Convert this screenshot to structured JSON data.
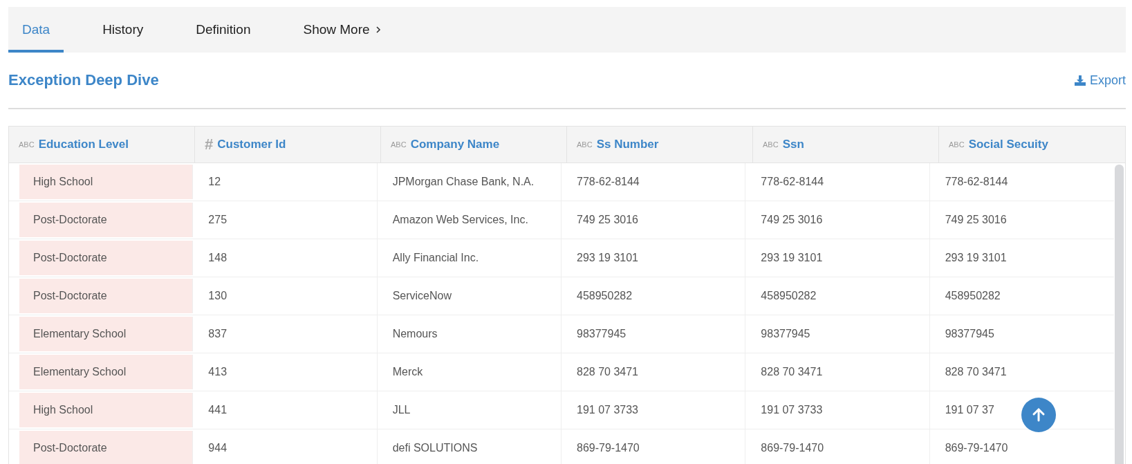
{
  "tabs": [
    {
      "label": "Data",
      "selected": true,
      "kind": "tab"
    },
    {
      "label": "History",
      "selected": false,
      "kind": "tab"
    },
    {
      "label": "Definition",
      "selected": false,
      "kind": "tab"
    },
    {
      "label": "Show More",
      "selected": false,
      "kind": "more"
    }
  ],
  "section": {
    "title": "Exception Deep Dive",
    "export_label": "Export"
  },
  "table": {
    "columns": [
      {
        "label": "Education Level",
        "kind": "text",
        "type_label": "ABC"
      },
      {
        "label": "Customer Id",
        "kind": "number",
        "type_label": "#"
      },
      {
        "label": "Company Name",
        "kind": "text",
        "type_label": "ABC"
      },
      {
        "label": "Ss Number",
        "kind": "text",
        "type_label": "ABC"
      },
      {
        "label": "Ssn",
        "kind": "text",
        "type_label": "ABC"
      },
      {
        "label": "Social Secuity",
        "kind": "text",
        "type_label": "ABC"
      }
    ],
    "rows": [
      {
        "flagged": true,
        "cells": [
          "High School",
          "12",
          "JPMorgan Chase Bank, N.A.",
          "778-62-8144",
          "778-62-8144",
          "778-62-8144"
        ]
      },
      {
        "flagged": true,
        "cells": [
          "Post-Doctorate",
          "275",
          "Amazon Web Services, Inc.",
          "749 25 3016",
          "749 25 3016",
          "749 25 3016"
        ]
      },
      {
        "flagged": true,
        "cells": [
          "Post-Doctorate",
          "148",
          "Ally Financial Inc.",
          "293 19 3101",
          "293 19 3101",
          "293 19 3101"
        ]
      },
      {
        "flagged": true,
        "cells": [
          "Post-Doctorate",
          "130",
          "ServiceNow",
          "458950282",
          "458950282",
          "458950282"
        ]
      },
      {
        "flagged": true,
        "cells": [
          "Elementary School",
          "837",
          "Nemours",
          "98377945",
          "98377945",
          "98377945"
        ]
      },
      {
        "flagged": true,
        "cells": [
          "Elementary School",
          "413",
          "Merck",
          "828 70 3471",
          "828 70 3471",
          "828 70 3471"
        ]
      },
      {
        "flagged": true,
        "cells": [
          "High School",
          "441",
          "JLL",
          "191 07 3733",
          "191 07 3733",
          "191 07 37"
        ]
      },
      {
        "flagged": true,
        "cells": [
          "Post-Doctorate",
          "944",
          "defi SOLUTIONS",
          "869-79-1470",
          "869-79-1470",
          "869-79-1470"
        ]
      }
    ]
  }
}
